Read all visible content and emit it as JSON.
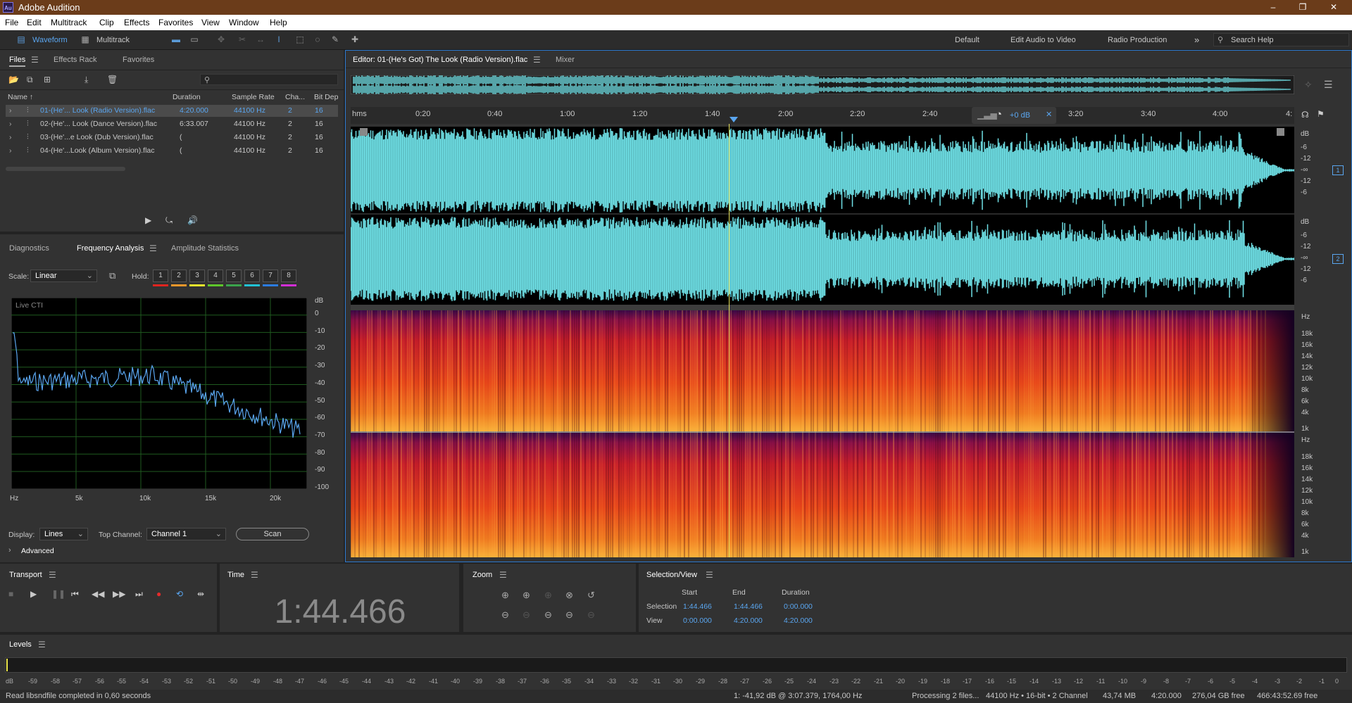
{
  "app": {
    "title": "Adobe Audition",
    "logo": "Au"
  },
  "window_controls": {
    "minimize": "–",
    "maximize": "❐",
    "close": "✕"
  },
  "menu": [
    "File",
    "Edit",
    "Multitrack",
    "Clip",
    "Effects",
    "Favorites",
    "View",
    "Window",
    "Help"
  ],
  "toolbar": {
    "waveform_label": "Waveform",
    "multitrack_label": "Multitrack",
    "workspaces": [
      "Default",
      "Edit Audio to Video",
      "Radio Production"
    ],
    "more": "»",
    "search_placeholder": "Search Help"
  },
  "files_panel": {
    "tabs": [
      "Files",
      "Effects Rack",
      "Favorites"
    ],
    "columns": [
      "Name ↑",
      "Duration",
      "Sample Rate",
      "Cha...",
      "Bit Dep"
    ],
    "rows": [
      {
        "name": "01-(He'... Look (Radio Version).flac",
        "duration": "4:20.000",
        "rate": "44100 Hz",
        "ch": "2",
        "bit": "16",
        "selected": true
      },
      {
        "name": "02-(He'... Look (Dance Version).flac",
        "duration": "6:33.007",
        "rate": "44100 Hz",
        "ch": "2",
        "bit": "16"
      },
      {
        "name": "03-(He'...e Look (Dub Version).flac",
        "duration": "(",
        "rate": "44100 Hz",
        "ch": "2",
        "bit": "16"
      },
      {
        "name": "04-(He'...Look (Album Version).flac",
        "duration": "(",
        "rate": "44100 Hz",
        "ch": "2",
        "bit": "16"
      }
    ]
  },
  "analysis_panel": {
    "tabs": [
      "Diagnostics",
      "Frequency Analysis",
      "Amplitude Statistics"
    ],
    "scale_label": "Scale:",
    "scale_value": "Linear",
    "hold_label": "Hold:",
    "hold_buttons": [
      "1",
      "2",
      "3",
      "4",
      "5",
      "6",
      "7",
      "8"
    ],
    "hold_colors": [
      "#e0241f",
      "#f0962a",
      "#e7e42c",
      "#5ec62a",
      "#3aa34c",
      "#21c1d4",
      "#2b7be0",
      "#d22ed6"
    ],
    "graph_label": "Live CTI",
    "db_labels": [
      "dB",
      "0",
      "-10",
      "-20",
      "-30",
      "-40",
      "-50",
      "-60",
      "-70",
      "-80",
      "-90",
      "-100"
    ],
    "hz_labels": [
      "Hz",
      "5k",
      "10k",
      "15k",
      "20k"
    ],
    "display_label": "Display:",
    "display_value": "Lines",
    "top_channel_label": "Top Channel:",
    "top_channel_value": "Channel 1",
    "scan_label": "Scan",
    "advanced_label": "Advanced"
  },
  "editor": {
    "tabs": [
      "Editor: 01-(He's Got) The Look (Radio Version).flac",
      "Mixer"
    ],
    "ruler": [
      "hms",
      "0:20",
      "0:40",
      "1:00",
      "1:20",
      "1:40",
      "2:00",
      "2:20",
      "2:40",
      "3:20",
      "3:40",
      "4:00",
      "4:"
    ],
    "hud_gain": "+0 dB",
    "db_ch1": [
      "dB",
      "-6",
      "-12",
      "-∞",
      "-12",
      "-6"
    ],
    "db_ch2": [
      "dB",
      "-6",
      "-12",
      "-∞",
      "-12",
      "-6"
    ],
    "hz_ch1": [
      "Hz",
      "18k",
      "16k",
      "14k",
      "12k",
      "10k",
      "8k",
      "6k",
      "4k",
      "1k"
    ],
    "hz_ch2": [
      "Hz",
      "18k",
      "16k",
      "14k",
      "12k",
      "10k",
      "8k",
      "6k",
      "4k",
      "1k"
    ],
    "channel_badges": [
      "1",
      "2"
    ],
    "waveform_color": "#6fe0e6"
  },
  "transport": {
    "title": "Transport"
  },
  "time": {
    "title": "Time",
    "value": "1:44.466"
  },
  "zoom": {
    "title": "Zoom"
  },
  "selection": {
    "title": "Selection/View",
    "headers": [
      "Start",
      "End",
      "Duration"
    ],
    "rows": [
      {
        "label": "Selection",
        "start": "1:44.466",
        "end": "1:44.466",
        "duration": "0:00.000"
      },
      {
        "label": "View",
        "start": "0:00.000",
        "end": "4:20.000",
        "duration": "4:20.000"
      }
    ]
  },
  "levels": {
    "title": "Levels",
    "scale": [
      "dB",
      "-59",
      "-58",
      "-57",
      "-56",
      "-55",
      "-54",
      "-53",
      "-52",
      "-51",
      "-50",
      "-49",
      "-48",
      "-47",
      "-46",
      "-45",
      "-44",
      "-43",
      "-42",
      "-41",
      "-40",
      "-39",
      "-38",
      "-37",
      "-36",
      "-35",
      "-34",
      "-33",
      "-32",
      "-31",
      "-30",
      "-29",
      "-28",
      "-27",
      "-26",
      "-25",
      "-24",
      "-23",
      "-22",
      "-21",
      "-20",
      "-19",
      "-18",
      "-17",
      "-16",
      "-15",
      "-14",
      "-13",
      "-12",
      "-11",
      "-10",
      "-9",
      "-8",
      "-7",
      "-6",
      "-5",
      "-4",
      "-3",
      "-2",
      "-1",
      "0"
    ]
  },
  "status": {
    "left": "Read libsndfile completed in 0,60 seconds",
    "cursor": "1: -41,92 dB @ 3:07.379, 1764,00 Hz",
    "processing": "Processing 2 files...",
    "format": "44100 Hz • 16-bit • 2 Channel",
    "size": "43,74 MB",
    "duration": "4:20.000",
    "free": "276,04 GB free",
    "free_time": "466:43:52.69 free"
  }
}
